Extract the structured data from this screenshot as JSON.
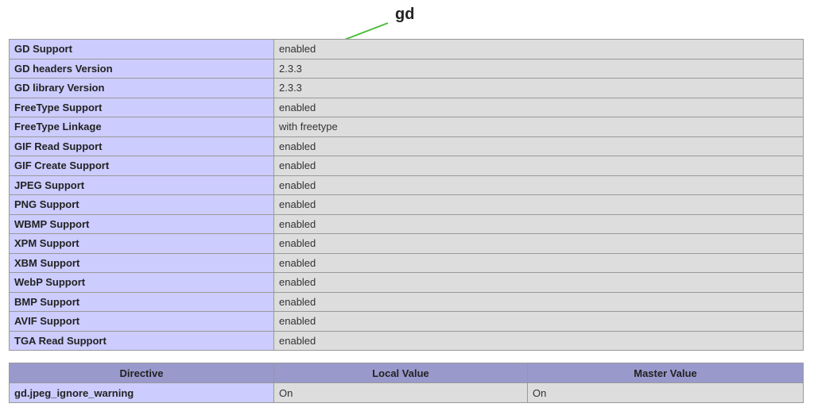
{
  "section": {
    "heading": "gd"
  },
  "annotation": {
    "color": "#4cbb3a",
    "icon": "arrow-icon"
  },
  "gd_table": {
    "rows": [
      {
        "name": "GD Support",
        "value": "enabled"
      },
      {
        "name": "GD headers Version",
        "value": "2.3.3"
      },
      {
        "name": "GD library Version",
        "value": "2.3.3"
      },
      {
        "name": "FreeType Support",
        "value": "enabled"
      },
      {
        "name": "FreeType Linkage",
        "value": "with freetype"
      },
      {
        "name": "GIF Read Support",
        "value": "enabled"
      },
      {
        "name": "GIF Create Support",
        "value": "enabled"
      },
      {
        "name": "JPEG Support",
        "value": "enabled"
      },
      {
        "name": "PNG Support",
        "value": "enabled"
      },
      {
        "name": "WBMP Support",
        "value": "enabled"
      },
      {
        "name": "XPM Support",
        "value": "enabled"
      },
      {
        "name": "XBM Support",
        "value": "enabled"
      },
      {
        "name": "WebP Support",
        "value": "enabled"
      },
      {
        "name": "BMP Support",
        "value": "enabled"
      },
      {
        "name": "AVIF Support",
        "value": "enabled"
      },
      {
        "name": "TGA Read Support",
        "value": "enabled"
      }
    ]
  },
  "directive_table": {
    "headers": {
      "directive": "Directive",
      "local": "Local Value",
      "master": "Master Value"
    },
    "rows": [
      {
        "directive": "gd.jpeg_ignore_warning",
        "local": "On",
        "master": "On"
      }
    ]
  },
  "colors": {
    "row_label_bg": "#ccccff",
    "row_value_bg": "#dddddd",
    "header_bg": "#9999cc",
    "border": "#999999"
  }
}
